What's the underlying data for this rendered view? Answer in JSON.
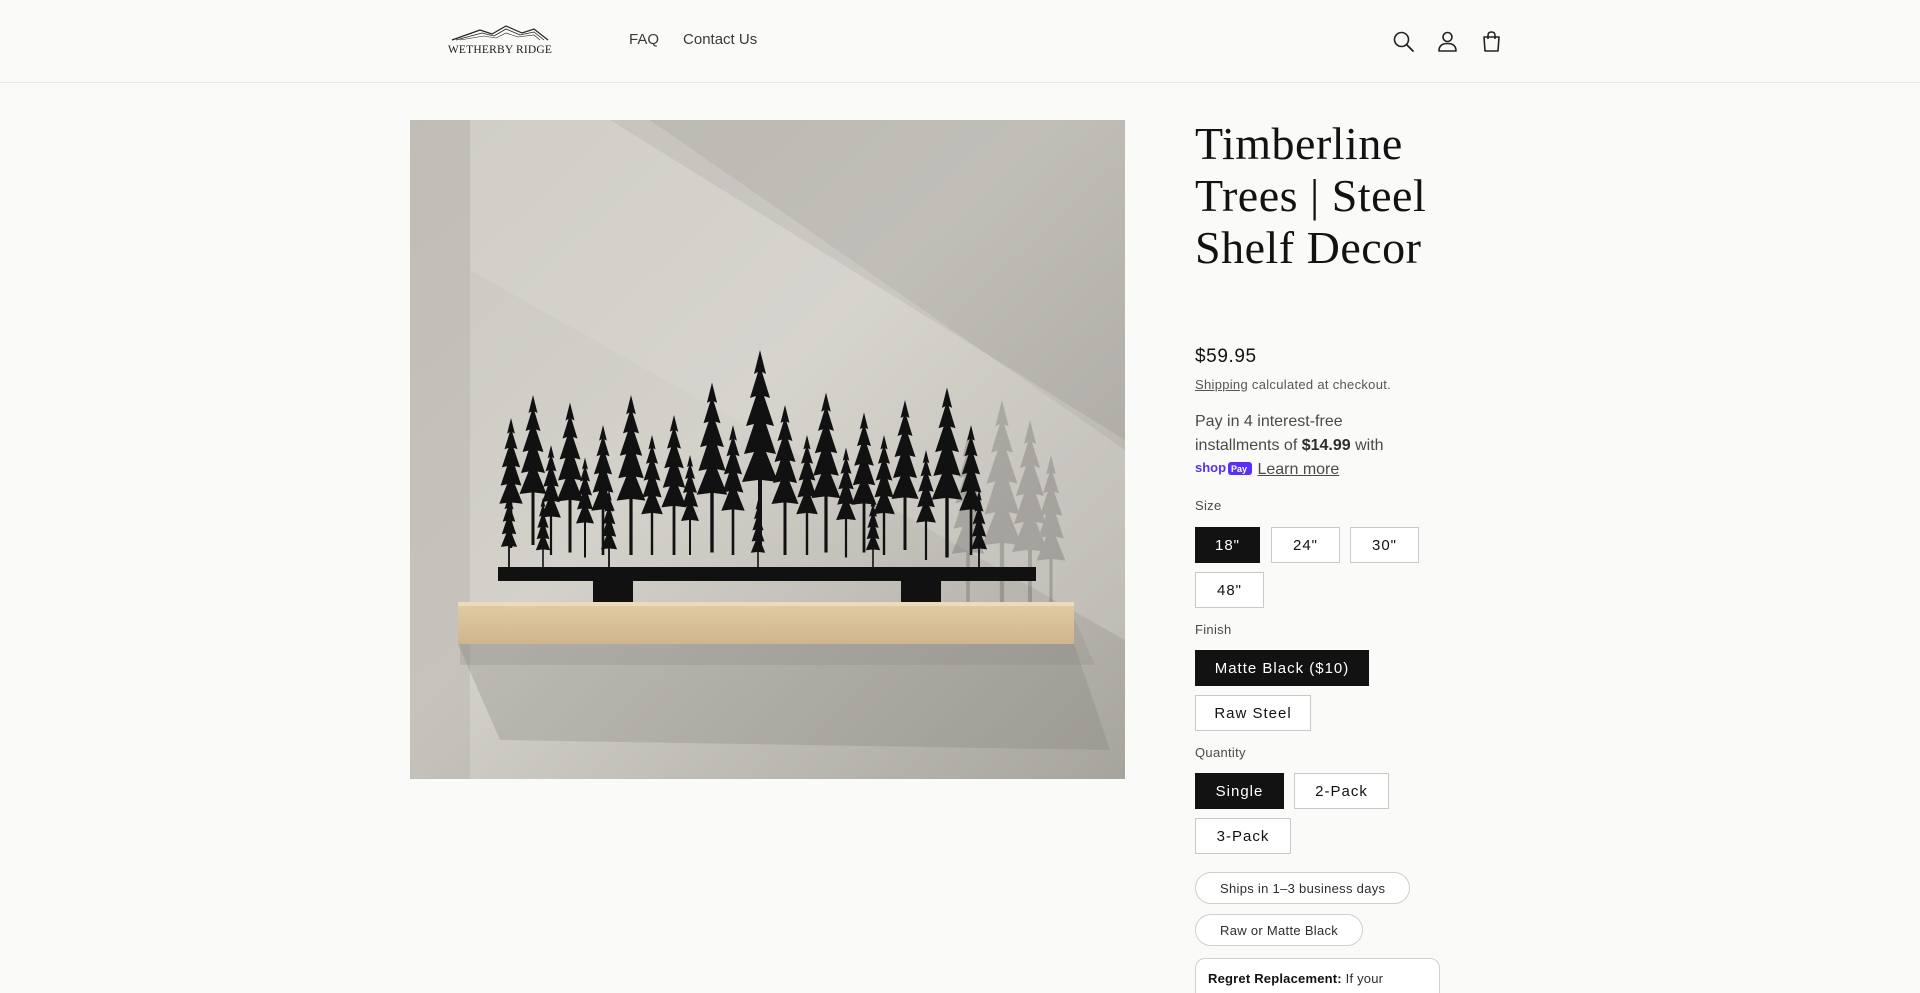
{
  "header": {
    "logo_text": "WETHERBY RIDGE",
    "nav": [
      {
        "label": "FAQ"
      },
      {
        "label": "Contact Us"
      }
    ],
    "icons": [
      "search-icon",
      "account-icon",
      "cart-icon"
    ]
  },
  "product": {
    "title": "Timberline Trees | Steel Shelf Decor",
    "price": "$59.95",
    "shipping_prefix": "Shipping",
    "shipping_suffix": " calculated at checkout.",
    "shoppay": {
      "text_before": "Pay in 4 interest-free installments of ",
      "amount": "$14.99",
      "text_after": " with",
      "logo_label": "shop Pay",
      "learn_more": "Learn more"
    },
    "options": {
      "size": {
        "label": "Size",
        "values": [
          "18\"",
          "24\"",
          "30\"",
          "48\""
        ],
        "selected": "18\""
      },
      "finish": {
        "label": "Finish",
        "values": [
          "Matte Black ($10)",
          "Raw Steel"
        ],
        "selected": "Matte Black ($10)"
      },
      "quantity": {
        "label": "Quantity",
        "values": [
          "Single",
          "2-Pack",
          "3-Pack"
        ],
        "selected": "Single"
      }
    },
    "tags": [
      "Ships in 1–3 business days",
      "Raw or Matte Black"
    ],
    "regret": {
      "title": "Regret Replacement:",
      "text": " If your"
    }
  },
  "colors": {
    "accent": "#121212",
    "shoppay": "#5a31f4",
    "background": "#fafaf8"
  }
}
